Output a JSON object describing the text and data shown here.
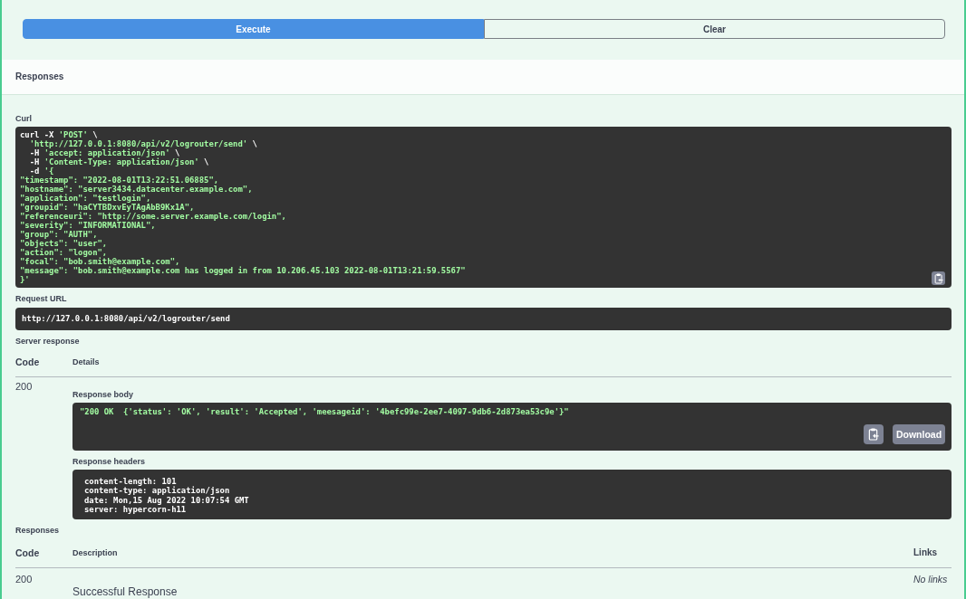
{
  "actions": [
    {
      "label": "Execute",
      "kind": "primary"
    },
    {
      "label": "Clear",
      "kind": "secondary"
    }
  ],
  "responses_header": {
    "title": "Responses"
  },
  "curl": {
    "label": "Curl",
    "lines": [
      [
        {
          "text": "curl -X ",
          "kind": "plain"
        },
        {
          "text": "'POST'",
          "kind": "string"
        },
        {
          "text": " \\",
          "kind": "plain"
        }
      ],
      [
        {
          "text": "  'http://127.0.0.1:8080/api/v2/logrouter/send'",
          "kind": "string"
        },
        {
          "text": " \\",
          "kind": "plain"
        }
      ],
      [
        {
          "text": "  -H ",
          "kind": "plain"
        },
        {
          "text": "'accept: application/json'",
          "kind": "string"
        },
        {
          "text": " \\",
          "kind": "plain"
        }
      ],
      [
        {
          "text": "  -H ",
          "kind": "plain"
        },
        {
          "text": "'Content-Type: application/json'",
          "kind": "string"
        },
        {
          "text": " \\",
          "kind": "plain"
        }
      ],
      [
        {
          "text": "  -d ",
          "kind": "plain"
        },
        {
          "text": "'{",
          "kind": "string"
        }
      ],
      [
        {
          "text": "\"timestamp\": \"2022-08-01T13:22:51.06885\",",
          "kind": "string"
        }
      ],
      [
        {
          "text": "\"hostname\": \"server3434.datacenter.example.com\",",
          "kind": "string"
        }
      ],
      [
        {
          "text": "\"application\": \"testlogin\",",
          "kind": "string"
        }
      ],
      [
        {
          "text": "\"groupid\": \"haCYTBDxvEyTAgAbB9Kx1A\",",
          "kind": "string"
        }
      ],
      [
        {
          "text": "\"referenceuri\": \"http://some.server.example.com/login\",",
          "kind": "string"
        }
      ],
      [
        {
          "text": "\"severity\": \"INFORMATIONAL\",",
          "kind": "string"
        }
      ],
      [
        {
          "text": "\"group\": \"AUTH\",",
          "kind": "string"
        }
      ],
      [
        {
          "text": "\"objects\": \"user\",",
          "kind": "string"
        }
      ],
      [
        {
          "text": "\"action\": \"logon\",",
          "kind": "string"
        }
      ],
      [
        {
          "text": "\"focal\": \"bob.smith@example.com\",",
          "kind": "string"
        }
      ],
      [
        {
          "text": "\"message\": \"bob.smith@example.com has logged in from 10.206.45.103 2022-08-01T13:21:59.5567\"",
          "kind": "string"
        }
      ],
      [
        {
          "text": "}'",
          "kind": "string"
        }
      ]
    ]
  },
  "request_url": {
    "label": "Request URL",
    "value": "http://127.0.0.1:8080/api/v2/logrouter/send"
  },
  "server_response": {
    "label": "Server response",
    "columns": [
      "Code",
      "Details"
    ],
    "rows": [
      {
        "code": "200",
        "body_label": "Response body",
        "body": "\"200 OK  {'status': 'OK', 'result': 'Accepted', 'meesageid': '4befc99e-2ee7-4097-9db6-2d873ea53c9e'}\"",
        "download": "Download",
        "headers_label": "Response headers",
        "headers": [
          "content-length: 101",
          "content-type: application/json",
          "date: Mon,15 Aug 2022 10:07:54 GMT",
          "server: hypercorn-h11"
        ]
      }
    ]
  },
  "responses": {
    "label": "Responses",
    "columns": [
      "Code",
      "Description",
      "Links"
    ],
    "rows": [
      {
        "code": "200",
        "description": "Successful Response",
        "links": "No links"
      }
    ]
  }
}
